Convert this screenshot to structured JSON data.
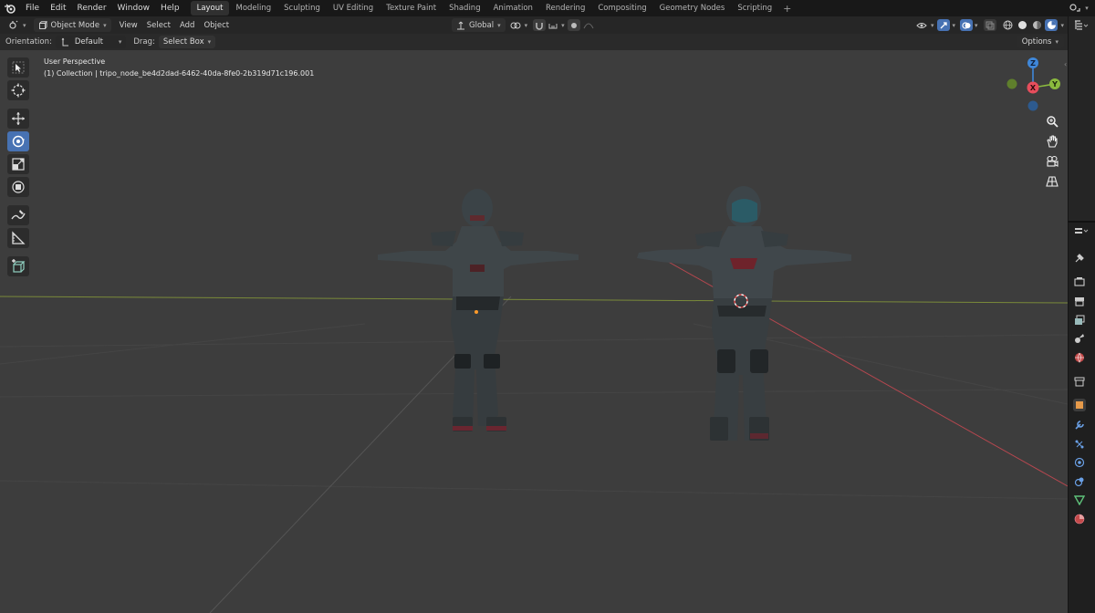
{
  "menu": {
    "items": [
      "File",
      "Edit",
      "Render",
      "Window",
      "Help"
    ]
  },
  "workspaces": {
    "tabs": [
      "Layout",
      "Modeling",
      "Sculpting",
      "UV Editing",
      "Texture Paint",
      "Shading",
      "Animation",
      "Rendering",
      "Compositing",
      "Geometry Nodes",
      "Scripting"
    ],
    "active": "Layout"
  },
  "header": {
    "mode": "Object Mode",
    "menus": [
      "View",
      "Select",
      "Add",
      "Object"
    ],
    "transform_orientation": "Global"
  },
  "tool_settings": {
    "orientation_label": "Orientation:",
    "orientation_value": "Default",
    "drag_label": "Drag:",
    "drag_value": "Select Box",
    "options_label": "Options"
  },
  "viewport": {
    "view_name": "User Perspective",
    "collection_info": "(1) Collection | tripo_node_be4d2dad-6462-40da-8fe0-2b319d71c196.001"
  },
  "gizmo": {
    "x_label": "X",
    "y_label": "Y",
    "z_label": "Z"
  },
  "colors": {
    "accent": "#4772b3",
    "x_axis": "#e64d5c",
    "y_axis": "#8bba3e",
    "z_axis": "#3f87d9",
    "viewport_bg": "#3d3d3d"
  }
}
